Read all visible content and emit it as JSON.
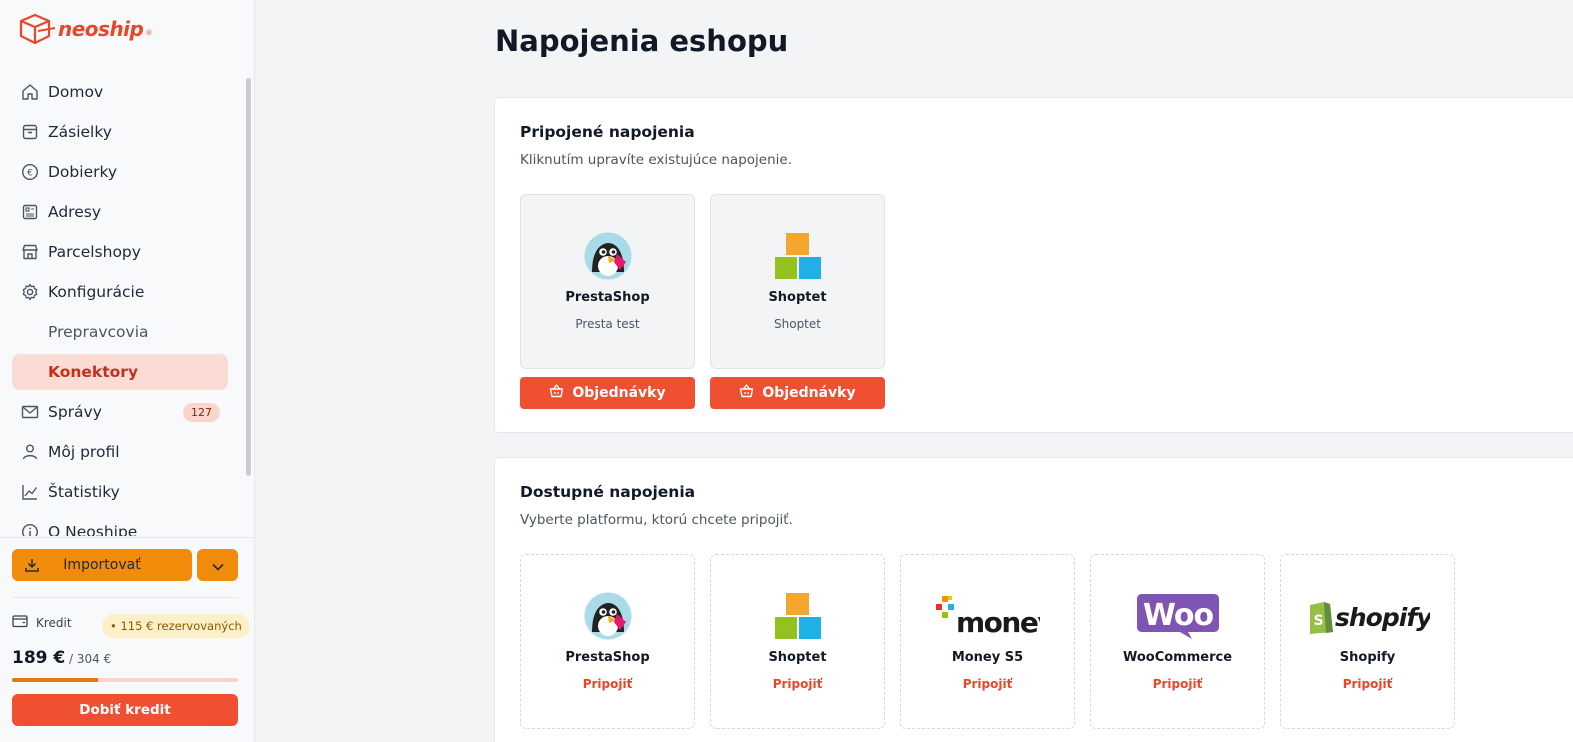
{
  "app": {
    "brand": "neoship",
    "brand_mark": "®"
  },
  "sidebar": {
    "items": [
      {
        "label": "Domov",
        "icon": "home-icon"
      },
      {
        "label": "Zásielky",
        "icon": "package-icon"
      },
      {
        "label": "Dobierky",
        "icon": "euro-icon"
      },
      {
        "label": "Adresy",
        "icon": "address-book-icon"
      },
      {
        "label": "Parcelshopy",
        "icon": "store-icon"
      },
      {
        "label": "Konfigurácie",
        "icon": "gear-icon"
      },
      {
        "label": "Prepravcovia"
      },
      {
        "label": "Konektory",
        "active": true
      },
      {
        "label": "Správy",
        "icon": "mail-icon",
        "badge": "127"
      },
      {
        "label": "Môj profil",
        "icon": "user-icon"
      },
      {
        "label": "Štatistiky",
        "icon": "chart-icon"
      },
      {
        "label": "O Neoshipe",
        "icon": "info-icon"
      }
    ],
    "import_label": "Importovať",
    "credit": {
      "label": "Kredit",
      "reserved": "• 115 € rezervovaných",
      "amount": "189 €",
      "of": " / 304 €",
      "progress": 0.38,
      "topup_label": "Dobiť kredit"
    }
  },
  "main": {
    "title": "Napojenia eshopu",
    "connected": {
      "title": "Pripojené napojenia",
      "subtitle": "Kliknutím upravíte existujúce napojenie.",
      "cards": [
        {
          "name": "PrestaShop",
          "desc": "Presta test",
          "logo": "prestashop-logo",
          "button": "Objednávky"
        },
        {
          "name": "Shoptet",
          "desc": "Shoptet",
          "logo": "shoptet-logo",
          "button": "Objednávky"
        }
      ]
    },
    "available": {
      "title": "Dostupné napojenia",
      "subtitle": "Vyberte platformu, ktorú chcete pripojiť.",
      "cards": [
        {
          "name": "PrestaShop",
          "action": "Pripojiť",
          "logo": "prestashop-logo"
        },
        {
          "name": "Shoptet",
          "action": "Pripojiť",
          "logo": "shoptet-logo"
        },
        {
          "name": "Money S5",
          "action": "Pripojiť",
          "logo": "money-logo",
          "logo_text": "money"
        },
        {
          "name": "WooCommerce",
          "action": "Pripojiť",
          "logo": "woocommerce-logo",
          "logo_text": "Woo"
        },
        {
          "name": "Shopify",
          "action": "Pripojiť",
          "logo": "shopify-logo",
          "logo_text": "shopify"
        }
      ]
    }
  },
  "colors": {
    "accent": "#ee5031",
    "import": "#f08c0a",
    "active_bg": "#fadcd5"
  }
}
